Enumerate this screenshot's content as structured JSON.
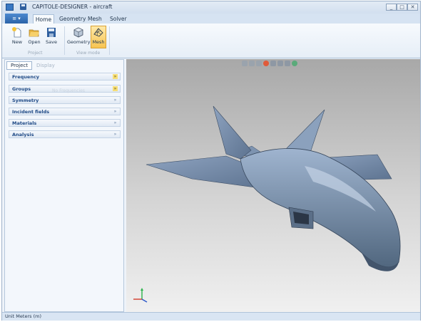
{
  "window": {
    "title": "CAPITOLE-DESIGNER - aircraft"
  },
  "title_buttons": {
    "minimize": "_",
    "maximize": "□",
    "close": "✕"
  },
  "ribbon": {
    "app_menu_label": "▾",
    "tabs": [
      "Home",
      "Geometry",
      "Mesh",
      "Solver"
    ],
    "groups": [
      {
        "label": "Project",
        "buttons": [
          "New",
          "Open",
          "Save"
        ]
      },
      {
        "label": "View mode",
        "buttons": [
          "Geometry",
          "Mesh"
        ]
      }
    ]
  },
  "left_panel": {
    "tabs": [
      "Project",
      "Display"
    ],
    "ghost_text": "No Frequencies",
    "sections": [
      "Frequency",
      "Groups",
      "Symmetry",
      "Incident fields",
      "Materials",
      "Analysis"
    ],
    "chevron": "»"
  },
  "icons": {
    "new": "new-document-icon",
    "open": "folder-open-icon",
    "save": "floppy-disk-icon",
    "geometry": "geometry-cube-icon",
    "mesh": "mesh-grid-icon",
    "axis": "axis-triad-icon"
  },
  "colors": {
    "accent": "#3a78c2",
    "selected_button": "#f7c452",
    "aircraft": "#7f98b8"
  },
  "status_bar": {
    "text": "Unit Meters (m)"
  }
}
